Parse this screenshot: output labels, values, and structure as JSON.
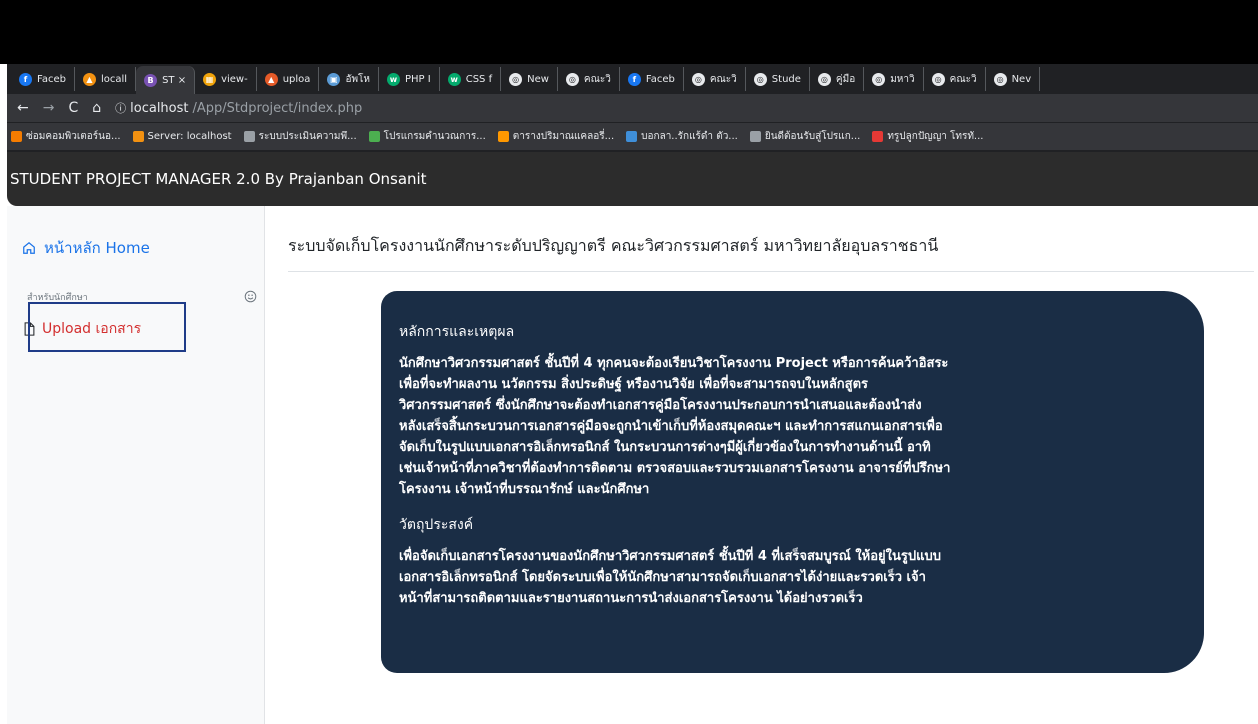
{
  "browser": {
    "tabs": [
      {
        "label": "Faceb",
        "color": "#1877f2",
        "glyph": "f"
      },
      {
        "label": "locall",
        "color": "#f29111",
        "glyph": "▲"
      },
      {
        "label": "ST ×",
        "color": "#7952b3",
        "glyph": "B",
        "active": true
      },
      {
        "label": "view-",
        "color": "#f0a30a",
        "glyph": "▦"
      },
      {
        "label": "uploa",
        "color": "#e55a28",
        "glyph": "▲"
      },
      {
        "label": "อัพโห",
        "color": "#5b9bd5",
        "glyph": "▣"
      },
      {
        "label": "PHP I",
        "color": "#04aa6d",
        "glyph": "w"
      },
      {
        "label": "CSS f",
        "color": "#04aa6d",
        "glyph": "w"
      },
      {
        "label": "New",
        "color": "#e8eaed",
        "glyph": "◎"
      },
      {
        "label": "คณะวิ",
        "color": "#e8eaed",
        "glyph": "◎"
      },
      {
        "label": "Faceb",
        "color": "#1877f2",
        "glyph": "f"
      },
      {
        "label": "คณะวิ",
        "color": "#e8eaed",
        "glyph": "◎"
      },
      {
        "label": "Stude",
        "color": "#e8eaed",
        "glyph": "◎"
      },
      {
        "label": "คู่มือ",
        "color": "#e8eaed",
        "glyph": "◎"
      },
      {
        "label": "มหาวิ",
        "color": "#e8eaed",
        "glyph": "◎"
      },
      {
        "label": "คณะวิ",
        "color": "#e8eaed",
        "glyph": "◎"
      },
      {
        "label": "Nev",
        "color": "#e8eaed",
        "glyph": "◎"
      }
    ],
    "url_host": "localhost",
    "url_path": "/App/Stdproject/index.php",
    "bookmarks": [
      {
        "label": "ซ่อมคอมพิวเตอร์นอ...",
        "color": "#f57c00"
      },
      {
        "label": "Server: localhost",
        "color": "#f29111"
      },
      {
        "label": "ระบบประเมินความพึ...",
        "color": "#9aa0a6"
      },
      {
        "label": "โปรแกรมคำนวณการ...",
        "color": "#4caf50"
      },
      {
        "label": "ตารางปริมาณแคลอรี่...",
        "color": "#ff9800"
      },
      {
        "label": "บอกลา..รักแร้ดำ ตัว...",
        "color": "#3f8fd9"
      },
      {
        "label": "ยินดีต้อนรับสู่โปรแก...",
        "color": "#9aa0a6"
      },
      {
        "label": "ทรูปลูกปัญญา โทรทั...",
        "color": "#e53935"
      }
    ]
  },
  "app": {
    "title": "STUDENT PROJECT MANAGER 2.0 By Prajanban Onsanit"
  },
  "sidebar": {
    "home_label": "หน้าหลัก Home",
    "section_label": "สำหรับนักศึกษา",
    "upload_label": "Upload เอกสาร"
  },
  "main": {
    "title": "ระบบจัดเก็บโครงงานนักศึกษาระดับปริญญาตรี คณะวิศวกรรมศาสตร์ มหาวิทยาลัยอุบลราชธานี",
    "card": {
      "heading1": "หลักการและเหตุผล",
      "body1": "นักศึกษาวิศวกรรมศาสตร์ ชั้นปีที่ 4 ทุกคนจะต้องเรียนวิชาโครงงาน Project หรือการค้นคว้าอิสระ\nเพื่อที่จะทำผลงาน นวัตกรรม สิ่งประดิษฐ์ หรืองานวิจัย เพื่อที่จะสามารถจบในหลักสูตร\nวิศวกรรมศาสตร์ ซึ่งนักศึกษาจะต้องทำเอกสารคู่มือโครงงานประกอบการนำเสนอและต้องนำส่ง\nหลังเสร็จสิ้นกระบวนการเอกสารคู่มือจะถูกนำเข้าเก็บที่ห้องสมุดคณะฯ และทำการสแกนเอกสารเพื่อ\nจัดเก็บในรูปแบบเอกสารอิเล็กทรอนิกส์ ในกระบวนการต่างๆมีผู้เกี่ยวข้องในการทำงานด้านนี้ อาทิ\nเช่นเจ้าหน้าที่ภาควิชาที่ต้องทำการติดตาม ตรวจสอบและรวบรวมเอกสารโครงงาน อาจารย์ที่ปรึกษา\nโครงงาน เจ้าหน้าที่บรรณารักษ์ และนักศึกษา",
      "heading2": "วัตถุประสงค์",
      "body2": "เพื่อจัดเก็บเอกสารโครงงานของนักศึกษาวิศวกรรมศาสตร์ ชั้นปีที่ 4 ที่เสร็จสมบูรณ์ ให้อยู่ในรูปแบบ\nเอกสารอิเล็กทรอนิกส์ โดยจัดระบบเพื่อให้นักศึกษาสามารถจัดเก็บเอกสารได้ง่ายและรวดเร็ว เจ้า\nหน้าที่สามารถติดตามและรายงานสถานะการนำส่งเอกสารโครงงาน ได้อย่างรวดเร็ว"
    }
  }
}
